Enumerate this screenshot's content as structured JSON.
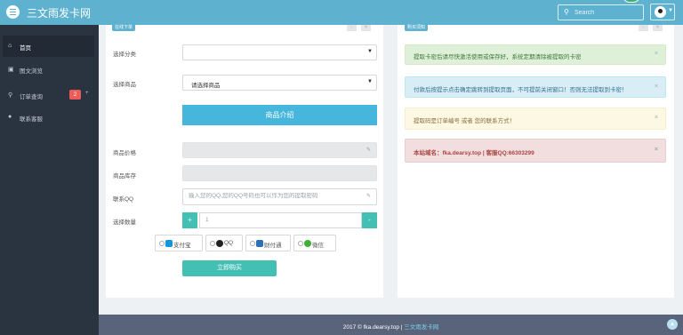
{
  "app": {
    "title": "三文雨发卡网"
  },
  "header": {
    "search_placeholder": "Search"
  },
  "sidebar": {
    "items": [
      {
        "label": "首页",
        "icon": "home-icon"
      },
      {
        "label": "图文浏览",
        "icon": "image-icon"
      },
      {
        "label": "订单查询",
        "icon": "search-icon",
        "badge": "2",
        "extra": "+"
      },
      {
        "label": "联系客服",
        "icon": "user-icon"
      }
    ]
  },
  "left_panel": {
    "tab_label": "在线下单",
    "fields": {
      "category_label": "选择分类",
      "product_label": "选择商品",
      "product_value": "请选择商品",
      "intro_button": "商品介绍",
      "price_label": "商品价格",
      "stock_label": "商品库存",
      "qq_label": "联系QQ",
      "qq_placeholder": "输入您的QQ,您的QQ号码也可以作为您的提取密码",
      "qty_label": "选择数量",
      "qty_value": "1",
      "qty_plus": "+",
      "qty_minus": "-"
    },
    "payments": [
      "支付宝",
      "QQ",
      "财付通",
      "微信"
    ],
    "buy_button": "立即购买"
  },
  "right_panel": {
    "tab_label": "购买须知",
    "alerts": [
      "提取卡密后请尽快激活使用或保存好，系统定期清除被提取的卡密",
      "付款后按提示点击确定跳转到提取页面，不可提前关闭窗口！否则无法提取到卡密！",
      "提取码是订单编号 或者 您的联系方式！",
      "本站域名：fka.dearsy.top | 客服QQ:66303299"
    ],
    "close_symbol": "×"
  },
  "panel_controls": {
    "collapse": "-",
    "close": "×"
  },
  "footer": {
    "copyright": "2017 © fka.dearsy.top |",
    "site_link": "三文雨发卡网"
  },
  "colors": {
    "header": "#5fb2cf",
    "sidebar": "#2a3441",
    "primary": "#44bfb3",
    "info_button": "#46b6dc"
  }
}
